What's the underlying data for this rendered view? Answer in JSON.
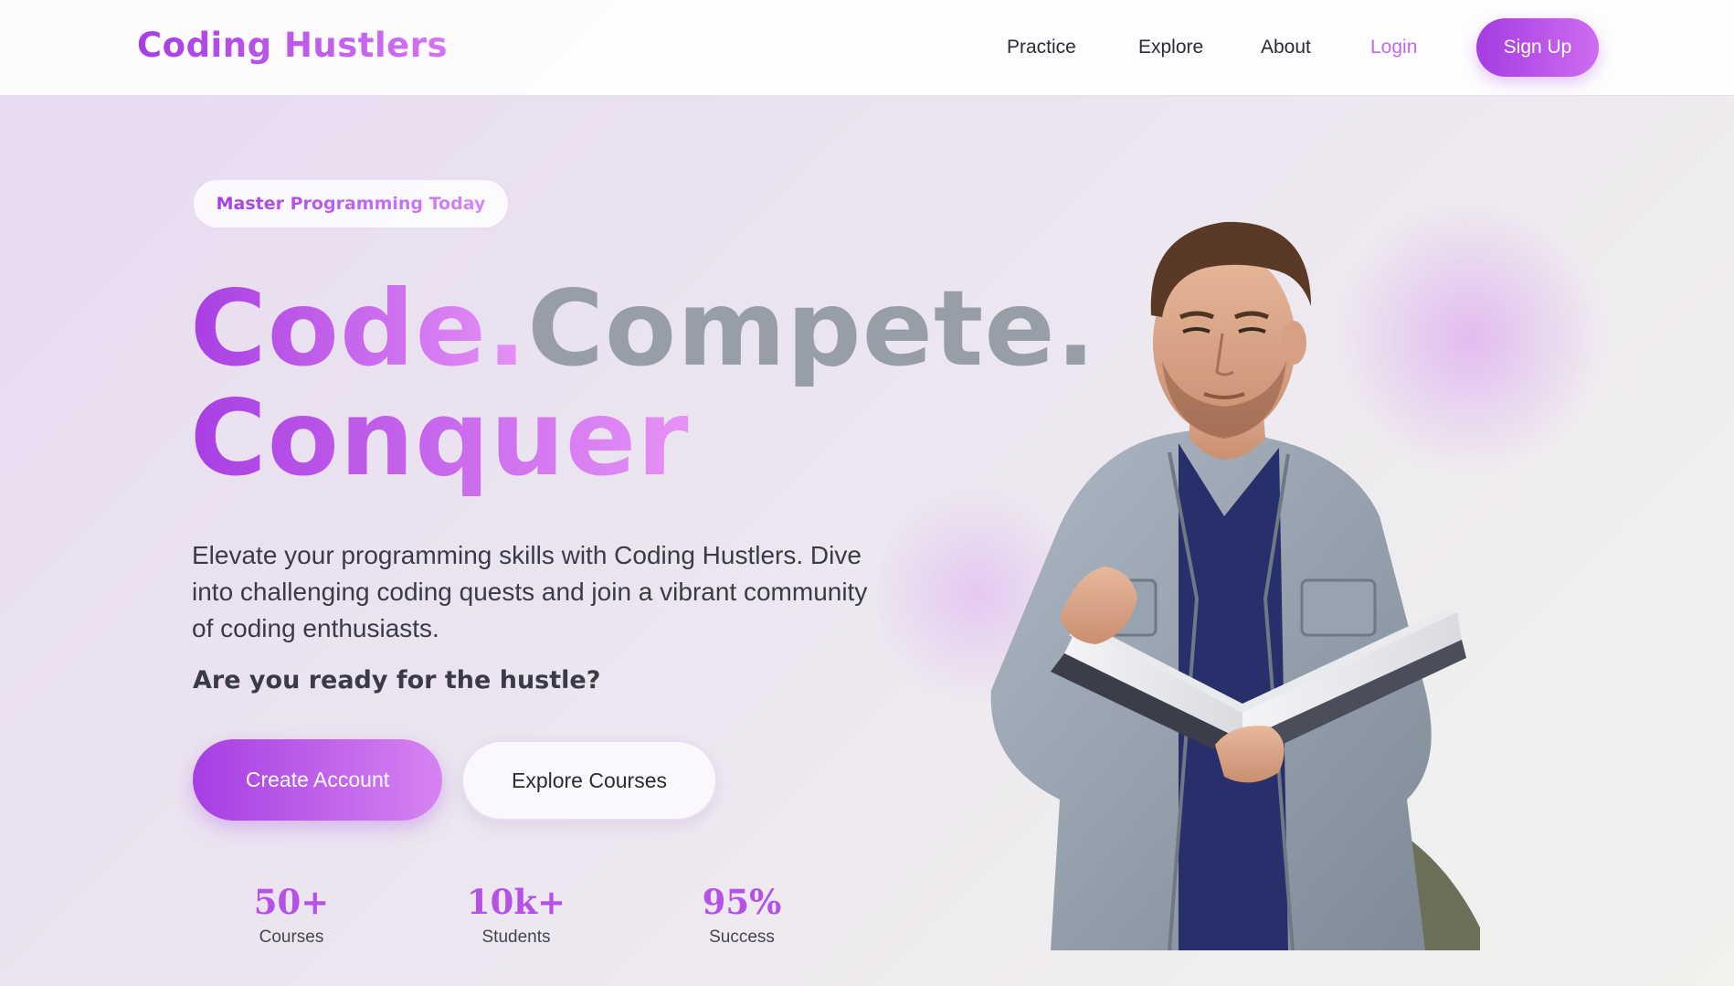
{
  "nav": {
    "brand": "Coding Hustlers",
    "links": [
      {
        "label": "Practice"
      },
      {
        "label": "Explore"
      },
      {
        "label": "About"
      },
      {
        "label": "Login"
      }
    ],
    "signup_label": "Sign Up"
  },
  "hero": {
    "badge": "Master Programming Today",
    "headline": {
      "word1": "Code.",
      "word2": "Compete.",
      "word3": "Conquer"
    },
    "description": "Elevate your programming skills with Coding Hustlers. Dive into challenging coding quests and join a vibrant community of coding enthusiasts.",
    "question": "Are you ready for the hustle?",
    "primary_cta": "Create Account",
    "secondary_cta": "Explore Courses",
    "stats": [
      {
        "value": "50+",
        "label": "Courses"
      },
      {
        "value": "10k+",
        "label": "Students"
      },
      {
        "value": "95%",
        "label": "Success"
      }
    ],
    "image": "student-reading-book"
  },
  "colors": {
    "accent": "#a63ee3",
    "accent_light": "#d783f1",
    "text_dark": "#3a3a48",
    "gray_headline": "#989ea8"
  }
}
